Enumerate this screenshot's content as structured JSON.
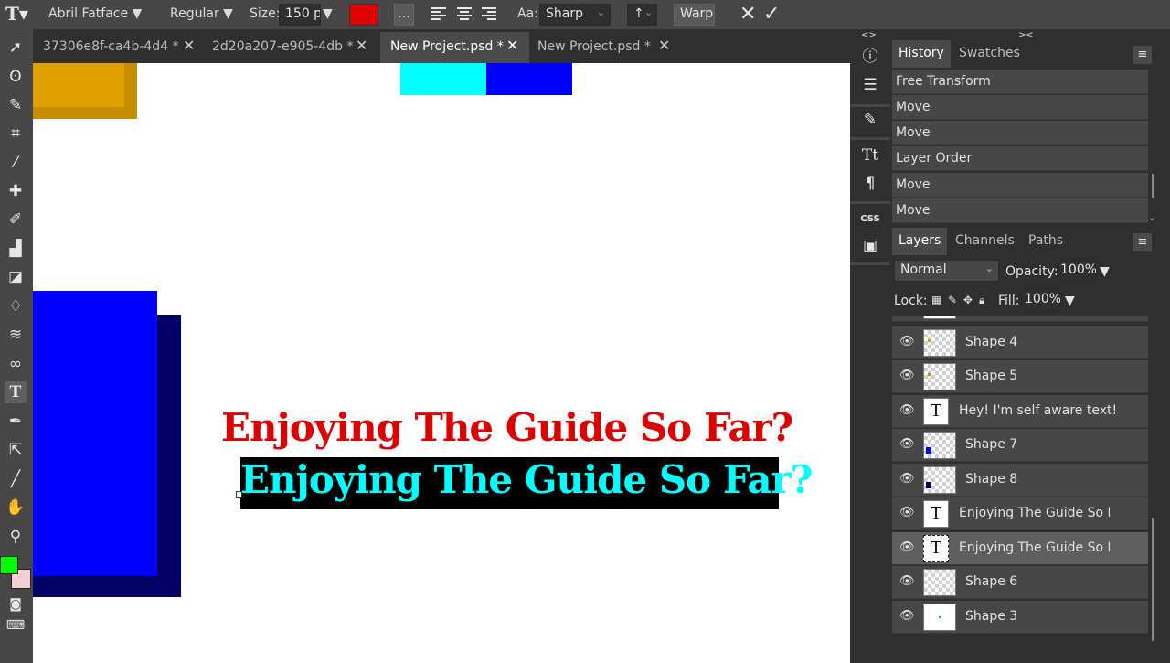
{
  "options_bar": {
    "font_family": "Abril Fatface",
    "font_style": "Regular",
    "size_label": "Size:",
    "size_value": "150 p:",
    "color_swatch": "#e00000",
    "more_label": "...",
    "antialias_label": "Aa:",
    "antialias_value": "Sharp",
    "direction_value": "↑",
    "warp_label": "Warp"
  },
  "tabs": [
    {
      "label": "37306e8f-ca4b-4d4 *"
    },
    {
      "label": "2d20a207-e905-4db *"
    },
    {
      "label": "New Project.psd *"
    },
    {
      "label": "New Project.psd *"
    }
  ],
  "canvas": {
    "text_red": "Enjoying The Guide So Far?",
    "text_cyan": "Enjoying The Guide So Far?",
    "colors": {
      "red": "#dd0000",
      "cyan": "#00ffff",
      "blue": "#0000ff",
      "navy": "#000066",
      "gold": "#e0a000"
    }
  },
  "history": {
    "tabs": [
      "History",
      "Swatches"
    ],
    "items": [
      "Free Transform",
      "Move",
      "Move",
      "Layer Order",
      "Move",
      "Move"
    ]
  },
  "layers_panel": {
    "tabs": [
      "Layers",
      "Channels",
      "Paths"
    ],
    "blend_mode": "Normal",
    "opacity_label": "Opacity:",
    "opacity_value": "100%",
    "lock_label": "Lock:",
    "fill_label": "Fill:",
    "fill_value": "100%",
    "layers": [
      {
        "name": "Shape 4",
        "kind": "shape"
      },
      {
        "name": "Shape 5",
        "kind": "shape"
      },
      {
        "name": "Hey! I'm self aware text!",
        "kind": "text"
      },
      {
        "name": "Shape 7",
        "kind": "shape"
      },
      {
        "name": "Shape 8",
        "kind": "shape"
      },
      {
        "name": "Enjoying The Guide So Fa",
        "kind": "text"
      },
      {
        "name": "Enjoying The Guide So Fa",
        "kind": "text"
      },
      {
        "name": "Shape 6",
        "kind": "shape"
      },
      {
        "name": "Shape 3",
        "kind": "shape"
      }
    ],
    "bottom_icons": [
      "link-icon",
      "effects-icon",
      "mask-icon",
      "adjustment-icon",
      "folder-icon",
      "new-layer-icon",
      "delete-icon"
    ]
  },
  "foreground_color": "#00ff00",
  "background_color": "#f4d0d0"
}
